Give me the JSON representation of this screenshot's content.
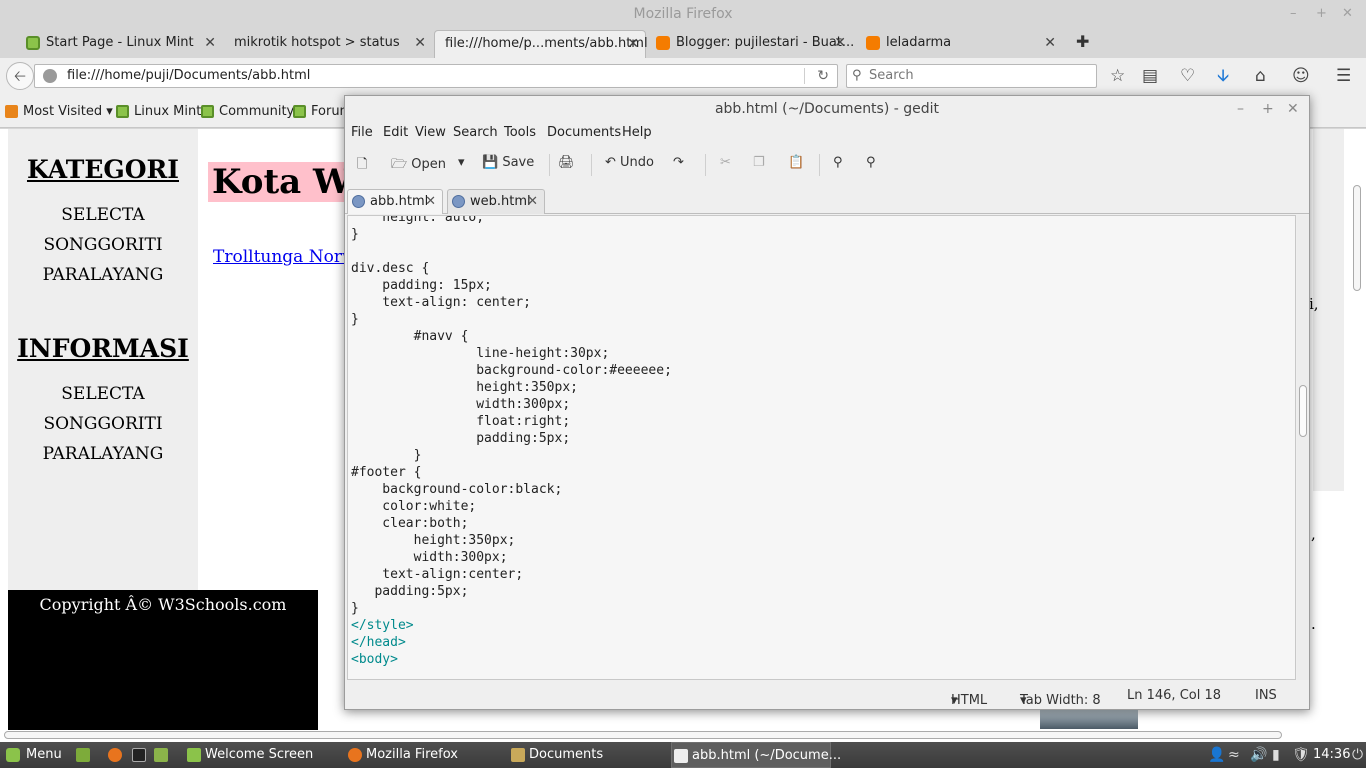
{
  "firefox": {
    "window_title": "Mozilla Firefox",
    "tabs": [
      {
        "label": "Start Page - Linux Mint",
        "icon": "linux-mint-icon"
      },
      {
        "label": "mikrotik hotspot > status",
        "icon": "globe-icon"
      },
      {
        "label": "file:///home/p...ments/abb.html",
        "icon": "globe-icon"
      },
      {
        "label": "Blogger: pujilestari - Buat...",
        "icon": "blogger-icon"
      },
      {
        "label": "leladarma",
        "icon": "blogger-icon"
      }
    ],
    "url": "file:///home/puji/Documents/abb.html",
    "search_placeholder": "Search",
    "bookmarks": [
      "Most Visited",
      "Linux Mint",
      "Community",
      "Forums"
    ]
  },
  "webpage": {
    "kategori_heading": "KATEGORI",
    "kategori_items": [
      "SELECTA",
      "SONGGORITI",
      "PARALAYANG"
    ],
    "informasi_heading": "INFORMASI",
    "informasi_items": [
      "SELECTA",
      "SONGGORITI",
      "PARALAYANG"
    ],
    "banner": "Kota Wisata",
    "link": "Trolltunga Norway",
    "footer": "Copyright Â© W3Schools.com",
    "fragments": [
      "i,",
      ",",
      "."
    ]
  },
  "gedit": {
    "title": "abb.html (~/Documents) - gedit",
    "menu": [
      "File",
      "Edit",
      "View",
      "Search",
      "Tools",
      "Documents",
      "Help"
    ],
    "toolbar": {
      "open": "Open",
      "save": "Save",
      "undo": "Undo"
    },
    "tabs": [
      "abb.html",
      "web.html"
    ],
    "code_lines": [
      "    height: auto;",
      "}",
      "",
      "div.desc {",
      "    padding: 15px;",
      "    text-align: center;",
      "}",
      "        #navv {",
      "                line-height:30px;",
      "                background-color:#eeeeee;",
      "                height:350px;",
      "                width:300px;",
      "                float:right;",
      "                padding:5px;",
      "        }",
      "#footer {",
      "    background-color:black;",
      "    color:white;",
      "    clear:both;",
      "        height:350px;",
      "        width:300px;",
      "    text-align:center;",
      "   padding:5px;",
      "}",
      "</style>",
      "</head>",
      "<body>"
    ],
    "status": {
      "language": "HTML",
      "tab_width": "Tab Width:  8",
      "position": "Ln 146, Col 18",
      "mode": "INS"
    }
  },
  "taskbar": {
    "menu": "Menu",
    "windows": [
      "Welcome Screen",
      "Mozilla Firefox",
      "Documents",
      "abb.html (~/Docume..."
    ],
    "clock": "14:36"
  }
}
